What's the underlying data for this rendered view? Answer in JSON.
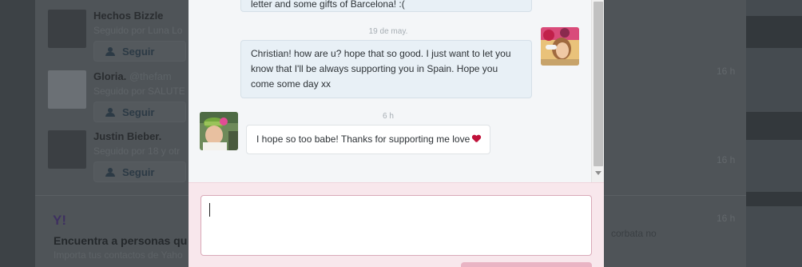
{
  "background": {
    "who_to_follow": [
      {
        "name": "Hechos Bizzle",
        "sub": "Seguido por Luna Lo",
        "follow_label": "Seguir"
      },
      {
        "name": "Gloria.",
        "sub": "Seguido por SALUTE",
        "follow_label": "Seguir"
      },
      {
        "name": "Justin Bieber.",
        "sub": "Seguido por 18 y otr",
        "follow_label": "Seguir"
      }
    ],
    "handle_fragment": "@thefam",
    "yahoo_logo": "Y!",
    "find_people": {
      "title": "Encuentra a personas qu",
      "subtitle": "Importa tus contactos de Yaho"
    },
    "timestamps": [
      "16 h",
      "16 h",
      "16 h"
    ],
    "side_link": "corbata no"
  },
  "conversation": {
    "messages": [
      {
        "direction": "out",
        "text": "letter and some gifts of Barcelona! :("
      },
      {
        "date": "19 de may."
      },
      {
        "direction": "out",
        "text": "Christian! how are u? hope that so good. I just want to let you know that I'll be always supporting you in Spain. Hope you come some day xx"
      },
      {
        "date": "6 h"
      },
      {
        "direction": "in",
        "text": "I hope so too babe! Thanks for supporting me love"
      }
    ],
    "compose_value": ""
  },
  "colors": {
    "bubble_out": "#e8f0f6",
    "compose_bg": "#f8e7ec",
    "heart": "#c0133b"
  }
}
